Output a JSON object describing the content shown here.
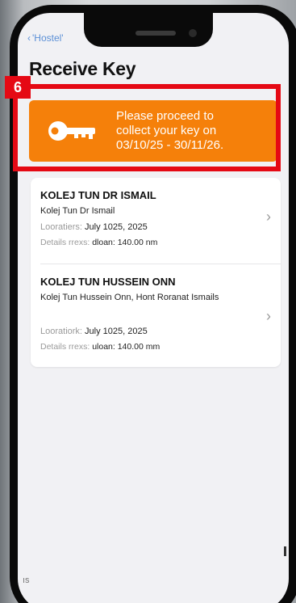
{
  "nav": {
    "back_label": "'Hostel'"
  },
  "page": {
    "title": "Receive Key"
  },
  "step": {
    "number": "6"
  },
  "banner": {
    "line1": "Please proceed to",
    "line2": "collect your key on",
    "line3": "03/10/25 - 30/11/26.",
    "color": "#f5800a"
  },
  "highlight_color": "#e50914",
  "hostels": [
    {
      "name": "KOLEJ TUN DR ISMAIL",
      "sub": "Kolej Tun Dr Ismail",
      "meta_key": "Looratiers:",
      "meta_val": "July 1025, 2025",
      "details_key": "Details rrexs:",
      "details_val": "dloan: 140.00 nm"
    },
    {
      "name": "KOLEJ TUN HUSSEIN ONN",
      "sub": "Kolej Tun Hussein Onn, Hont Roranat Ismails",
      "meta_key": "Looratiork:",
      "meta_val": "July 1025, 2025",
      "details_key": "Details rrexs:",
      "details_val": "uloan: 140.00 mm"
    }
  ],
  "footer": {
    "text": "ıs"
  }
}
